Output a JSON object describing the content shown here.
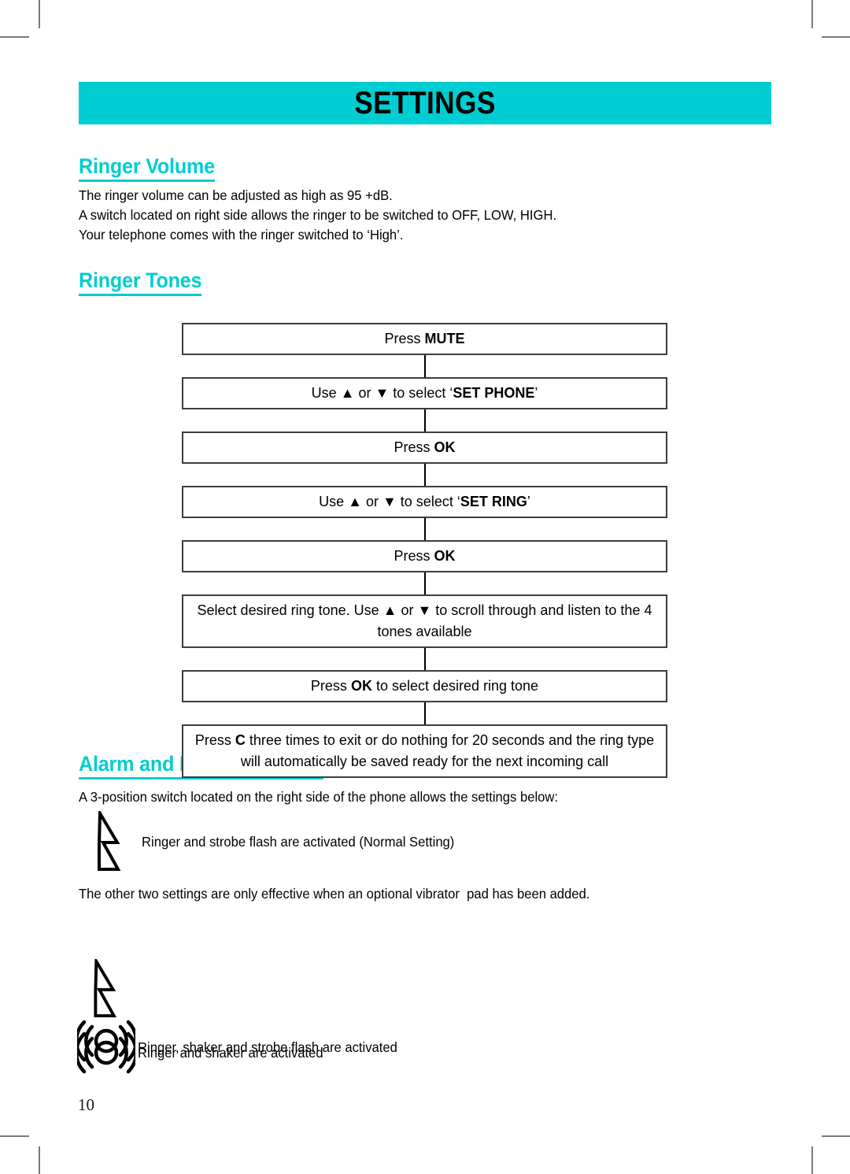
{
  "page": {
    "number": "10",
    "banner_title": "SETTINGS"
  },
  "sections": {
    "ringer_volume": {
      "heading": "Ringer Volume",
      "body": "The ringer volume can be adjusted as high as 95 +dB.\nA switch located on right side allows the ringer to be switched to OFF, LOW, HIGH.\nYour telephone comes with the ringer switched to ‘High’."
    },
    "ringer_tones": {
      "heading": "Ringer Tones",
      "steps": [
        {
          "pre": "Press ",
          "strong": "MUTE",
          "post": ""
        },
        {
          "pre": "Use ▲ or ▼ to select ‘",
          "strong": "SET PHONE",
          "post": "’"
        },
        {
          "pre": "Press ",
          "strong": "OK",
          "post": ""
        },
        {
          "pre": "Use ▲ or ▼ to select ‘",
          "strong": "SET RING",
          "post": "’"
        },
        {
          "pre": "Press ",
          "strong": "OK",
          "post": ""
        },
        {
          "pre": "Select desired ring tone.  Use ▲ or ▼ to scroll through and listen to the 4 tones available",
          "strong": "",
          "post": ""
        },
        {
          "pre": "Press ",
          "strong": "OK",
          "post": " to select desired ring tone"
        },
        {
          "pre": "Press ",
          "strong": "C",
          "post": " three times to exit or do nothing for 20 seconds and the ring type will automatically be saved ready for the next incoming call"
        }
      ]
    },
    "alarm_and_ringer": {
      "heading": "Alarm and Ringer Settings",
      "intro": "A 3-position switch located on the right side of the phone allows the settings below:",
      "note": "The other two settings are only effective when an optional vibrator  pad has been added.",
      "options": [
        {
          "icons": [
            "strobe-flash-icon"
          ],
          "label": "Ringer and strobe flash are activated (Normal Setting)"
        },
        {
          "icons": [
            "strobe-flash-icon",
            "shaker-vibration-icon"
          ],
          "label": "Ringer, shaker and strobe flash are activated"
        },
        {
          "icons": [
            "shaker-vibration-icon"
          ],
          "label": "Ringer and shaker are activated"
        }
      ]
    }
  },
  "colors": {
    "accent_teal": "#00cdd1",
    "box_border": "#3d3d3d",
    "text": "#000000"
  }
}
